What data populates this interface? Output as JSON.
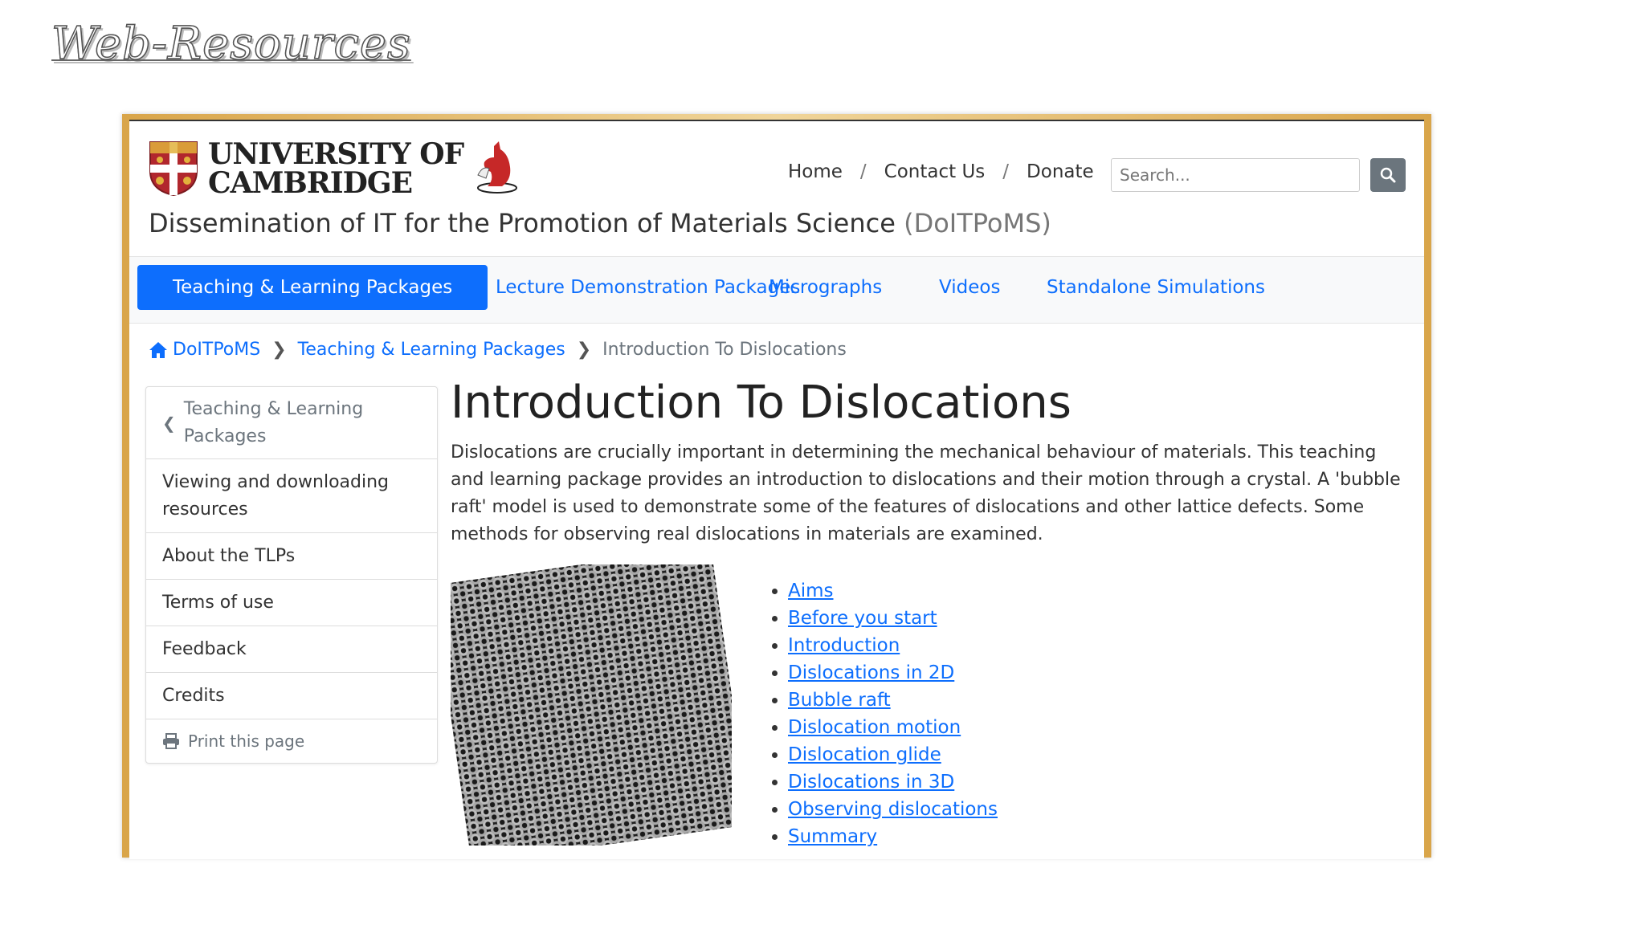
{
  "slide": {
    "title": "Web-Resources"
  },
  "header": {
    "university_line1": "UNIVERSITY OF",
    "university_line2": "CAMBRIDGE",
    "nav": {
      "home": "Home",
      "contact": "Contact Us",
      "donate": "Donate",
      "separator": "/"
    },
    "search_placeholder": "Search...",
    "site_title": "Dissemination of IT for the Promotion of Materials Science",
    "site_abbr": "(DoITPoMS)"
  },
  "mainnav": {
    "items": [
      {
        "label": "Teaching & Learning Packages",
        "active": true
      },
      {
        "label": "Lecture Demonstration Packages",
        "active": false
      },
      {
        "label": "Micrographs",
        "active": false
      },
      {
        "label": "Videos",
        "active": false
      },
      {
        "label": "Standalone Simulations",
        "active": false
      }
    ]
  },
  "breadcrumb": {
    "home": "DoITPoMS",
    "section": "Teaching & Learning Packages",
    "current": "Introduction To Dislocations"
  },
  "sidebar": {
    "back": "Teaching & Learning Packages",
    "items": [
      "Viewing and downloading resources",
      "About the TLPs",
      "Terms of use",
      "Feedback",
      "Credits"
    ],
    "print": "Print this page"
  },
  "content": {
    "heading": "Introduction To Dislocations",
    "intro": "Dislocations are crucially important in determining the mechanical behaviour of materials. This teaching and learning package provides an introduction to dislocations and their motion through a crystal. A 'bubble raft' model is used to demonstrate some of the features of dislocations and other lattice defects. Some methods for observing real dislocations in materials are examined.",
    "toc": [
      "Aims",
      "Before you start",
      "Introduction",
      "Dislocations in 2D",
      "Bubble raft",
      "Dislocation motion",
      "Dislocation glide",
      "Dislocations in 3D",
      "Observing dislocations",
      "Summary"
    ]
  },
  "colors": {
    "primary": "#0d6efd",
    "frame": "#d9a54a",
    "search_button": "#6b757d"
  },
  "icons": [
    "search-icon",
    "home-icon",
    "chevron-left-icon",
    "chevron-right-icon",
    "printer-icon",
    "crest-icon",
    "kangaroo-icon"
  ]
}
